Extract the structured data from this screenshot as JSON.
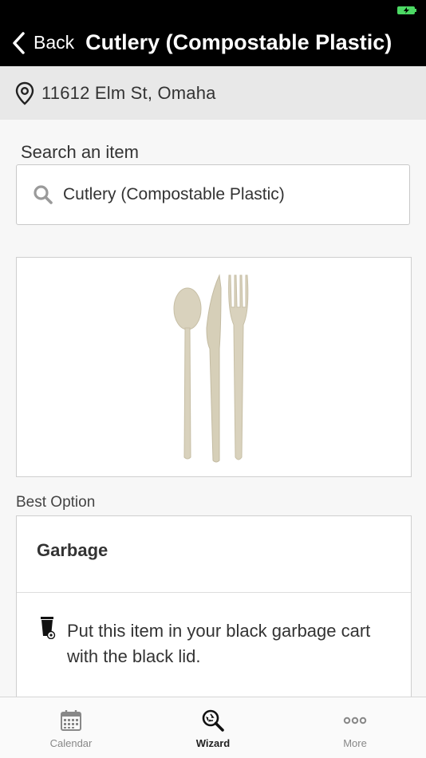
{
  "nav": {
    "back_label": "Back",
    "title": "Cutlery (Compostable Plastic)"
  },
  "location": {
    "address": "11612 Elm St, Omaha"
  },
  "search": {
    "label": "Search an item",
    "value": "Cutlery (Compostable Plastic)"
  },
  "item_image": {
    "icon": "cutlery-image"
  },
  "best_option": {
    "section_label": "Best Option",
    "title": "Garbage",
    "description": "Put this item in your black garbage cart with the black lid.",
    "icon": "garbage-cart-icon"
  },
  "tabs": [
    {
      "label": "Calendar",
      "icon": "calendar-icon",
      "active": false
    },
    {
      "label": "Wizard",
      "icon": "wizard-recycle-search-icon",
      "active": true
    },
    {
      "label": "More",
      "icon": "more-dots-icon",
      "active": false
    }
  ],
  "colors": {
    "header_bg": "#000000",
    "address_bg": "#e8e8e8",
    "battery": "#4cd964",
    "cutlery": "#d9d2bd"
  }
}
